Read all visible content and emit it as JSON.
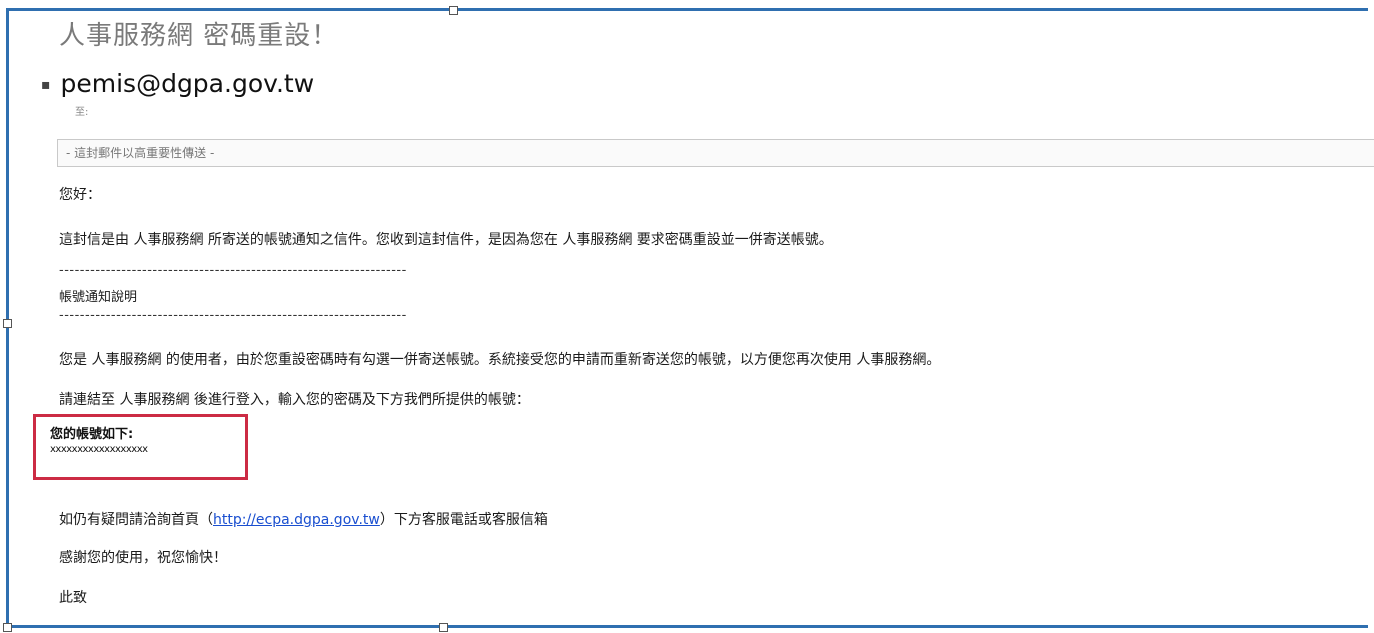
{
  "email": {
    "subject": "人事服務網 密碼重設！",
    "sender": "pemis@dgpa.gov.tw",
    "to_label": "至:",
    "importance_notice": "- 這封郵件以高重要性傳送 -",
    "greeting": "您好：",
    "intro": "這封信是由 人事服務網 所寄送的帳號通知之信件。您收到這封信件，是因為您在 人事服務網 要求密碼重設並一併寄送帳號。",
    "separator": "-------------------------------------------------------------------",
    "section_title": "帳號通知說明",
    "para1": "您是 人事服務網 的使用者，由於您重設密碼時有勾選一併寄送帳號。系統接受您的申請而重新寄送您的帳號，以方便您再次使用 人事服務網。",
    "para2": "請連結至 人事服務網 後進行登入，輸入您的密碼及下方我們所提供的帳號：",
    "account_label": "您的帳號如下:",
    "account_value": "xxxxxxxxxxxxxxxxxx",
    "help_prefix": "如仍有疑問請洽詢首頁（",
    "help_link": "http://ecpa.dgpa.gov.tw",
    "help_suffix": "）下方客服電話或客服信箱",
    "thanks": "感謝您的使用，祝您愉快！",
    "closing": "此致"
  },
  "colors": {
    "frame_border": "#2f6fb0",
    "highlight_box": "#cc2b44",
    "link": "#1a4fd0"
  }
}
